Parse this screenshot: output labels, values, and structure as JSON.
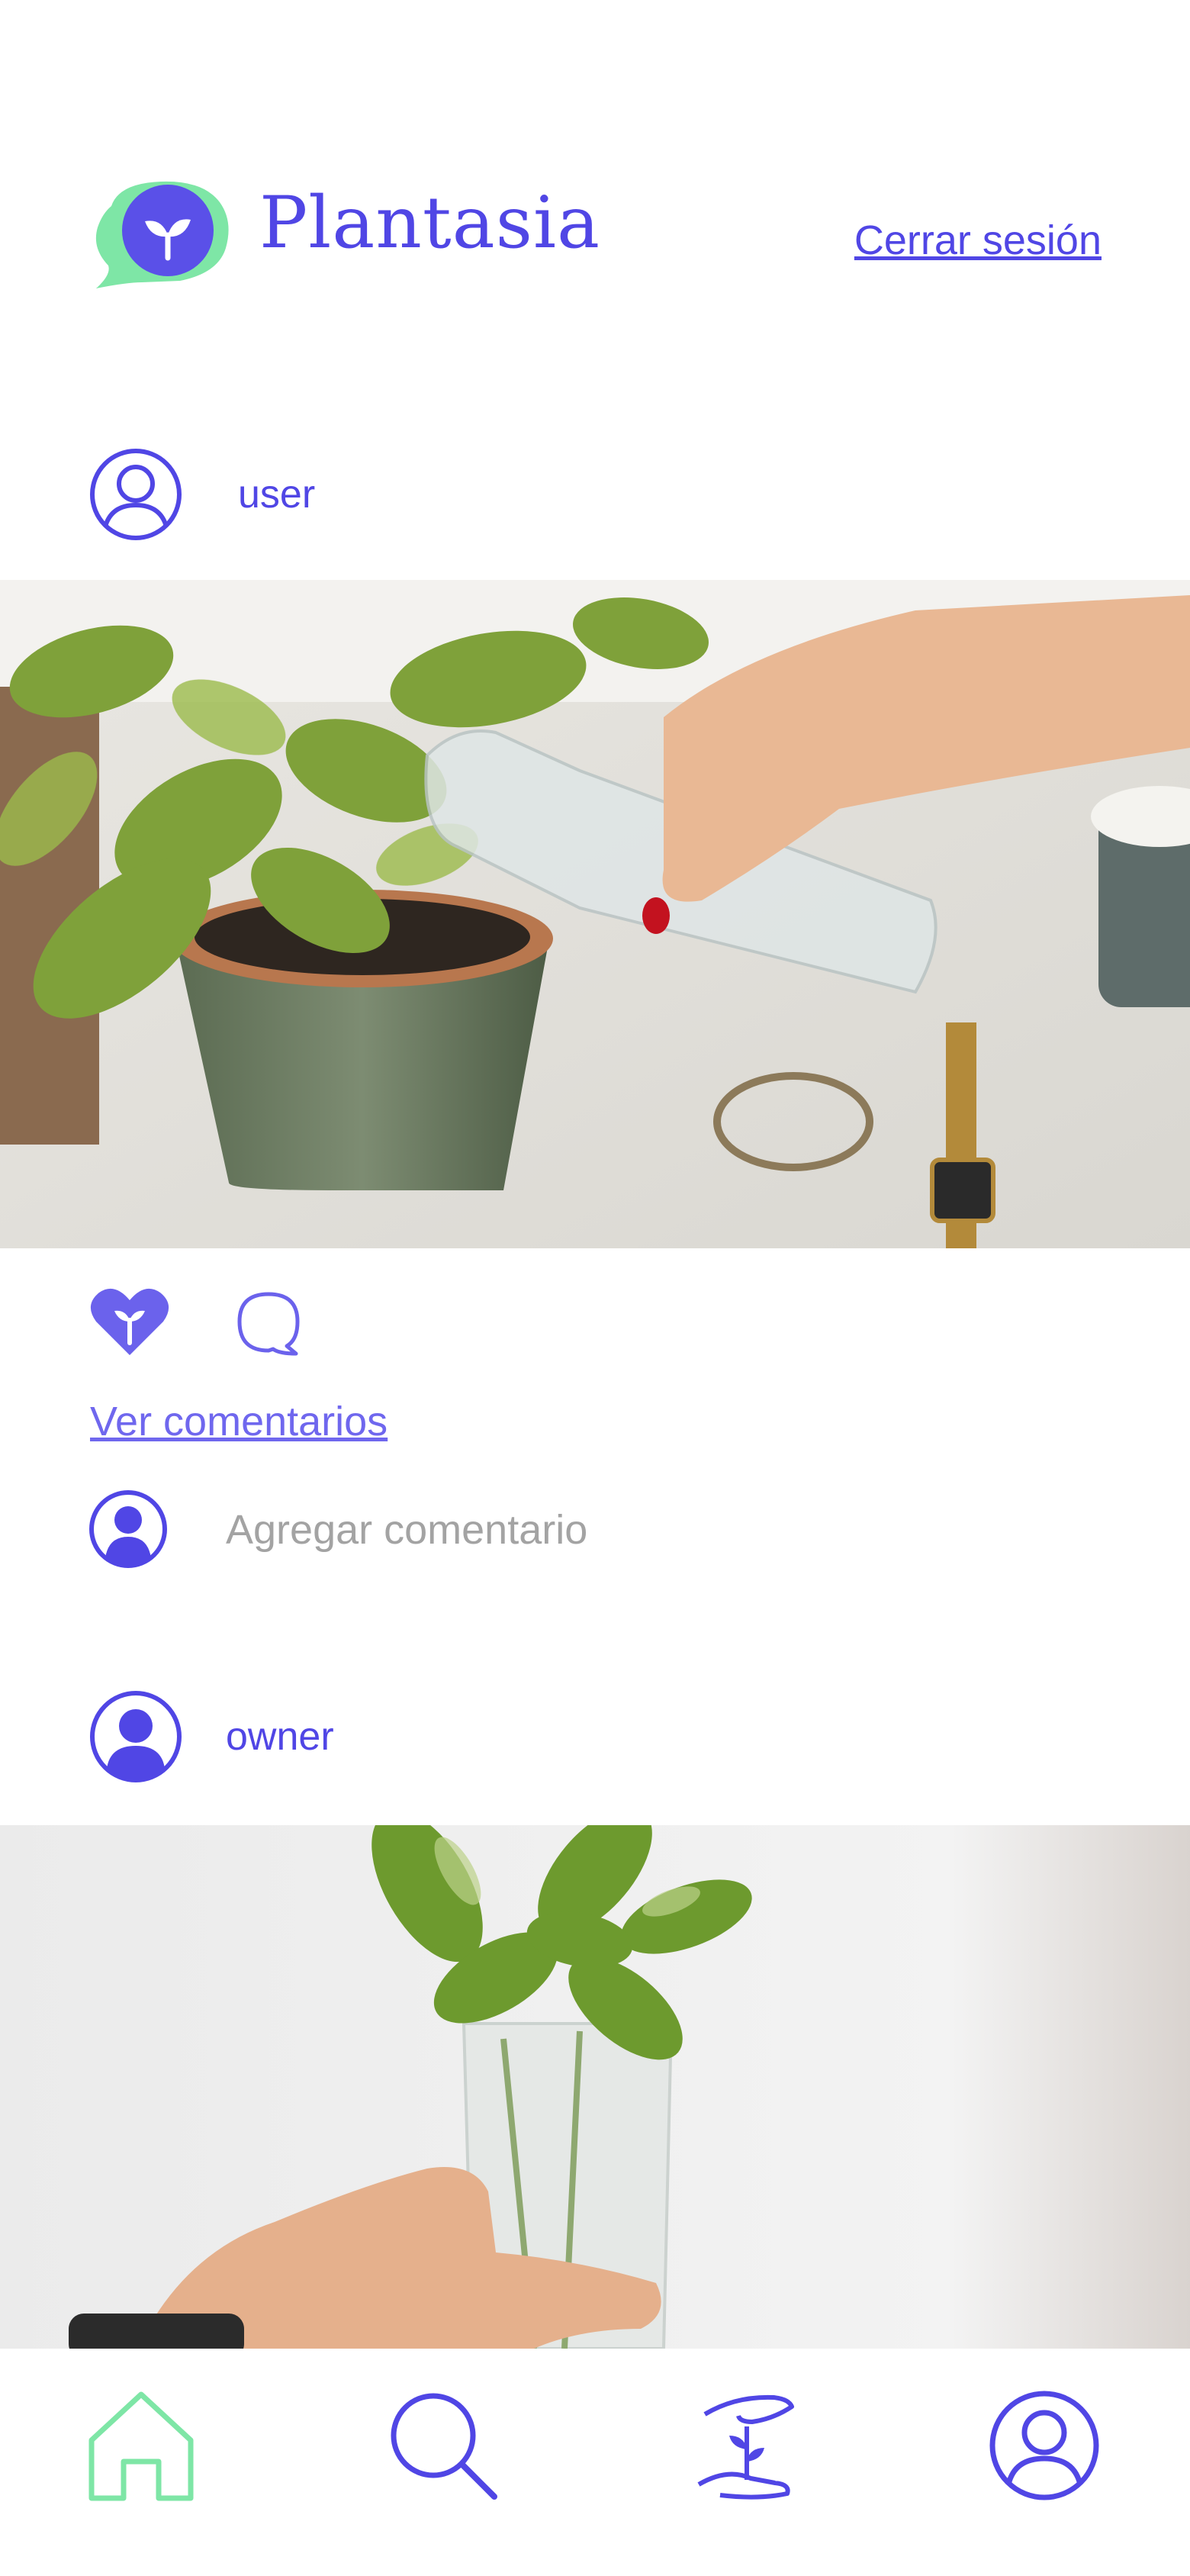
{
  "app": {
    "name": "Plantasia",
    "logout_label": "Cerrar sesión"
  },
  "colors": {
    "brand": "#5046e5",
    "accent_green": "#7ee6a6",
    "muted_text": "#a3a3a3",
    "link_light": "#6f67ee"
  },
  "feed": {
    "posts": [
      {
        "username": "user",
        "avatar_icon": "user-outline-icon",
        "image_description": "hand watering potted pothos plant from glass bottle",
        "actions": {
          "like_icon": "heart-sprout-icon",
          "comment_icon": "speech-bubble-icon",
          "view_comments_label": "Ver comentarios"
        },
        "comment_input": {
          "placeholder": "Agregar comentario",
          "value": ""
        }
      },
      {
        "username": "owner",
        "avatar_icon": "user-filled-icon",
        "image_description": "hand holding glass with pothos cuttings in water"
      }
    ]
  },
  "bottom_nav": {
    "items": [
      {
        "id": "home",
        "icon": "home-icon",
        "active": true
      },
      {
        "id": "search",
        "icon": "search-icon",
        "active": false
      },
      {
        "id": "care",
        "icon": "hands-plant-icon",
        "active": false
      },
      {
        "id": "profile",
        "icon": "user-outline-icon",
        "active": false
      }
    ]
  }
}
